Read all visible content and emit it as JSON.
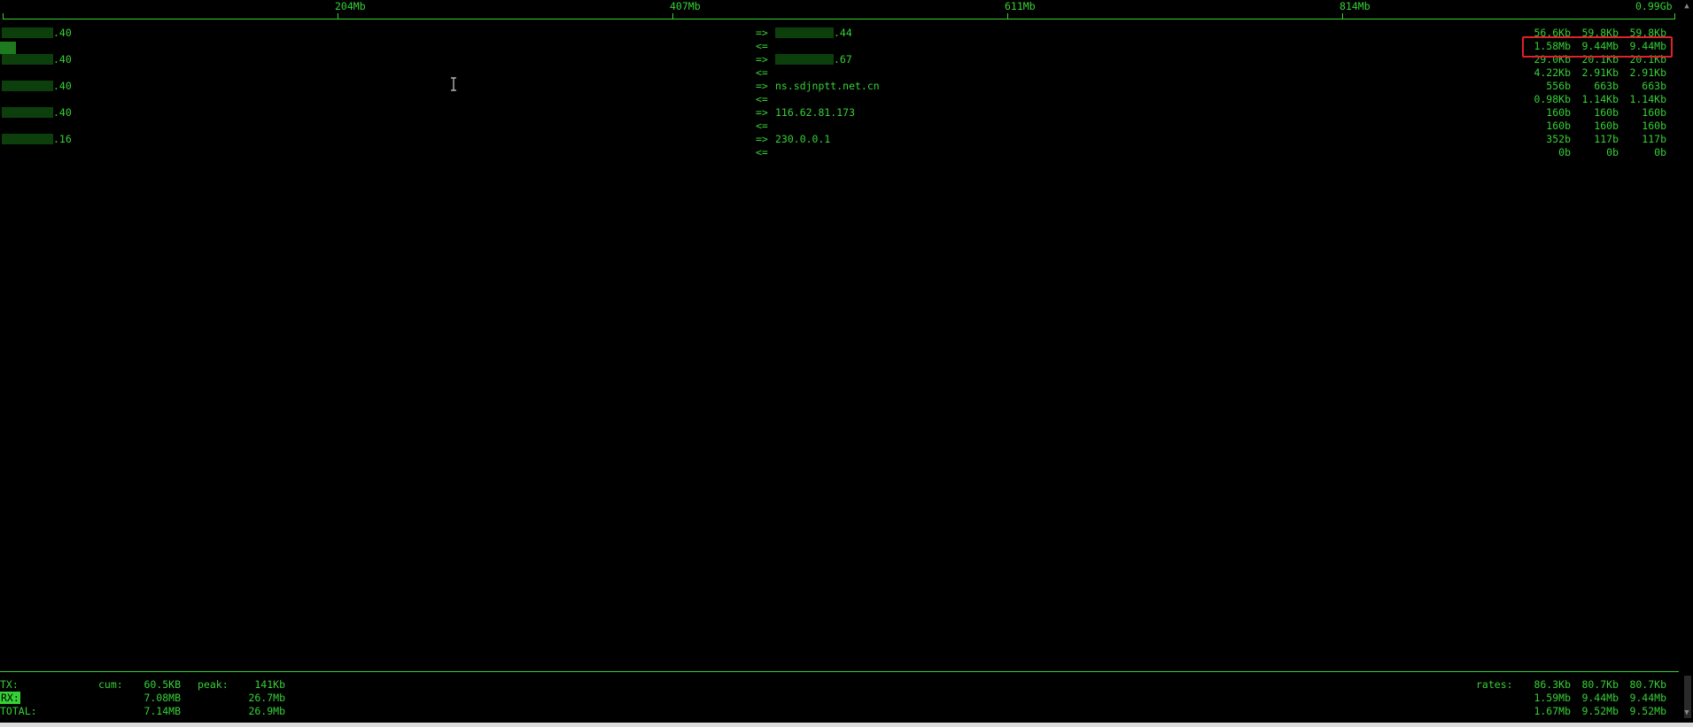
{
  "scale": {
    "ticks": [
      "204Mb",
      "407Mb",
      "611Mb",
      "814Mb",
      "0.99Gb"
    ]
  },
  "hosts": [
    {
      "local_suffix": ".40",
      "out_arrow": "=>",
      "remote": ".44",
      "in_arrow": "<=",
      "tx": [
        "56.6Kb",
        "59.8Kb",
        "59.8Kb"
      ],
      "rx": [
        "1.58Mb",
        "9.44Mb",
        "9.44Mb"
      ]
    },
    {
      "local_suffix": ".40",
      "out_arrow": "=>",
      "remote": ".67",
      "in_arrow": "<=",
      "tx": [
        "29.0Kb",
        "20.1Kb",
        "20.1Kb"
      ],
      "rx": [
        "4.22Kb",
        "2.91Kb",
        "2.91Kb"
      ]
    },
    {
      "local_suffix": ".40",
      "out_arrow": "=>",
      "remote": "ns.sdjnptt.net.cn",
      "in_arrow": "<=",
      "tx": [
        "556b",
        "663b",
        "663b"
      ],
      "rx": [
        "0.98Kb",
        "1.14Kb",
        "1.14Kb"
      ]
    },
    {
      "local_suffix": ".40",
      "out_arrow": "=>",
      "remote": "116.62.81.173",
      "in_arrow": "<=",
      "tx": [
        "160b",
        "160b",
        "160b"
      ],
      "rx": [
        "160b",
        "160b",
        "160b"
      ]
    },
    {
      "local_suffix": ".16",
      "out_arrow": "=>",
      "remote": "230.0.0.1",
      "in_arrow": "<=",
      "tx": [
        "352b",
        "117b",
        "117b"
      ],
      "rx": [
        "0b",
        "0b",
        "0b"
      ]
    }
  ],
  "footer": {
    "tx_label": "TX:",
    "rx_label": "RX:",
    "total_label": "TOTAL:",
    "cum_label": "cum:",
    "peak_label": "peak:",
    "rates_label": "rates:",
    "tx_cum": "60.5KB",
    "rx_cum": "7.08MB",
    "total_cum": "7.14MB",
    "tx_peak": "141Kb",
    "rx_peak": "26.7Mb",
    "total_peak": "26.9Mb",
    "tx_rates": [
      "86.3Kb",
      "80.7Kb",
      "80.7Kb"
    ],
    "rx_rates": [
      "1.59Mb",
      "9.44Mb",
      "9.44Mb"
    ],
    "total_rates": [
      "1.67Mb",
      "9.52Mb",
      "9.52Mb"
    ]
  },
  "colors": {
    "foreground": "#36d136",
    "background": "#000000",
    "highlight_box": "#e0202a"
  }
}
